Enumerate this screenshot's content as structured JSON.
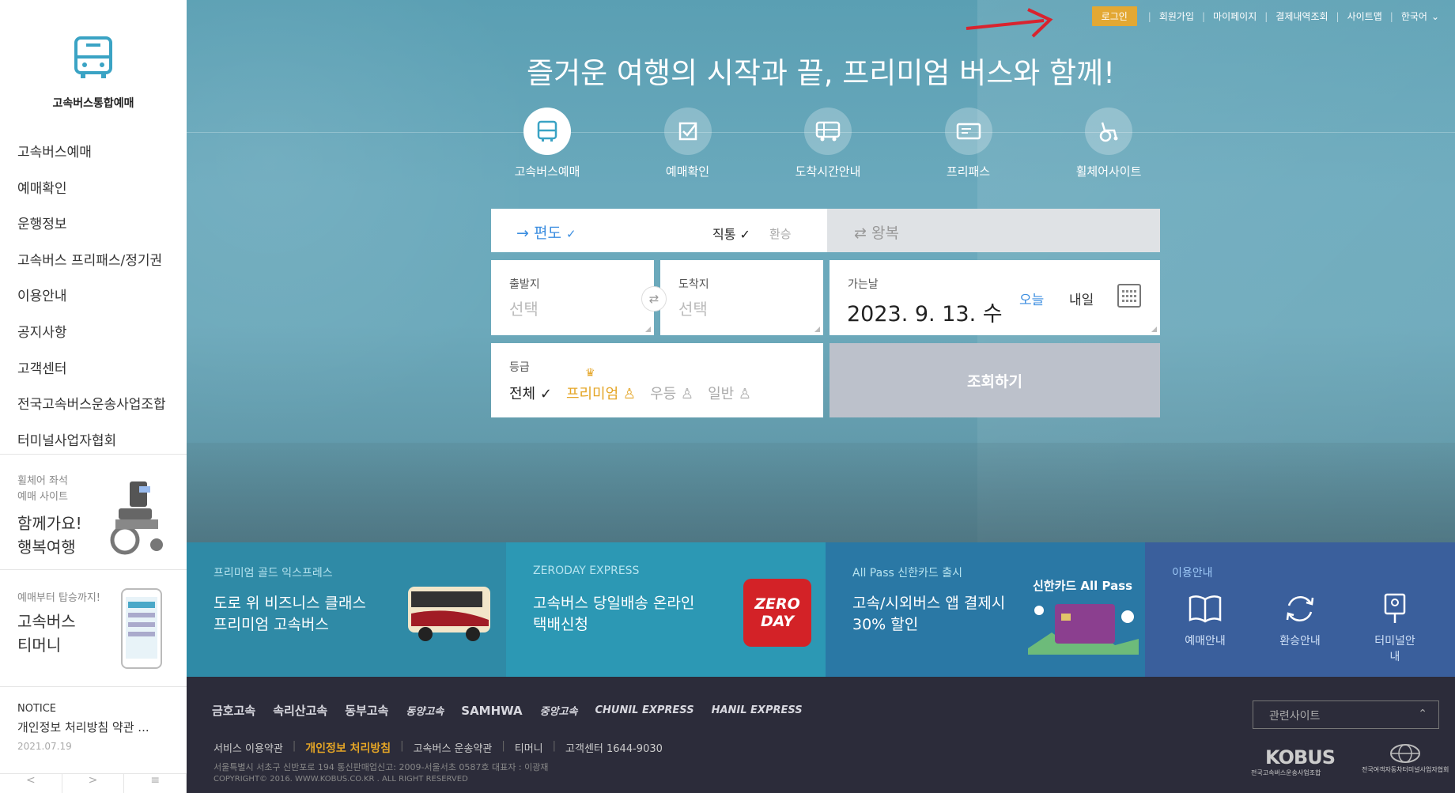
{
  "sidebar": {
    "logo_text": "고속버스통합예매",
    "nav": [
      "고속버스예매",
      "예매확인",
      "운행정보",
      "고속버스 프리패스/정기권",
      "이용안내",
      "공지사항",
      "고객센터",
      "전국고속버스운송사업조합",
      "터미널사업자협회"
    ],
    "promo_wheelchair": {
      "small": "휠체어 좌석\n예매 사이트",
      "big": "함께가요!\n행복여행"
    },
    "promo_money": {
      "small": "예매부터 탑승까지!",
      "big": "고속버스\n티머니"
    },
    "notice": {
      "label": "NOTICE",
      "title": "개인정보 처리방침 약관 ...",
      "date": "2021.07.19"
    },
    "bottom": [
      "<",
      ">",
      "≡"
    ]
  },
  "topnav": {
    "login": "로그인",
    "items": [
      "회원가입",
      "마이페이지",
      "결제내역조회",
      "사이트맵",
      "한국어"
    ]
  },
  "hero": {
    "headline": "즐거운 여행의 시작과 끝, 프리미엄 버스와 함께!"
  },
  "tabs": [
    "고속버스예매",
    "예매확인",
    "도착시간안내",
    "프리패스",
    "휠체어사이트"
  ],
  "booking": {
    "oneway": "편도",
    "direct": "직통",
    "transfer": "환승",
    "roundtrip": "왕복",
    "from_label": "출발지",
    "from_value": "선택",
    "to_label": "도착지",
    "to_value": "선택",
    "date_label": "가는날",
    "date_value": "2023. 9. 13. 수",
    "today": "오늘",
    "tomorrow": "내일",
    "grade_label": "등급",
    "grade_all": "전체",
    "grade_premium": "프리미엄",
    "grade_superior": "우등",
    "grade_normal": "일반",
    "search": "조회하기"
  },
  "banners": [
    {
      "sub": "프리미엄 골드 익스프레스",
      "title": "도로 위 비즈니스 클래스 프리미엄 고속버스"
    },
    {
      "sub": "ZERODAY EXPRESS",
      "title": "고속버스 당일배송 온라인 택배신청",
      "logo": "ZERO DAY"
    },
    {
      "sub": "All Pass 신한카드 출시",
      "title": "고속/시외버스 앱 결제시 30% 할인",
      "card": "신한카드 All Pass"
    },
    {
      "sub": "이용안내",
      "links": [
        "예매안내",
        "환승안내",
        "터미널안내"
      ]
    }
  ],
  "footer": {
    "partners": [
      "금호고속",
      "속리산고속",
      "동부고속",
      "동양고속",
      "SAMHWA",
      "중앙고속",
      "CHUNIL EXPRESS",
      "HANIL EXPRESS"
    ],
    "links": [
      "서비스 이용약관",
      "개인정보 처리방침",
      "고속버스 운송약관",
      "티머니",
      "고객센터 1644-9030"
    ],
    "address": "서울특별시 서초구 신반포로 194 통신판매업신고: 2009-서울서초 0587호 대표자 : 이광재",
    "copyright": "COPYRIGHT© 2016. WWW.KOBUS.CO.KR . ALL RIGHT RESERVED",
    "related": "관련사이트",
    "kobus": "KOBUS",
    "kobus_sub": "전국고속버스운송사업조합",
    "assoc": "전국여객자동차터미널사업자협회"
  }
}
